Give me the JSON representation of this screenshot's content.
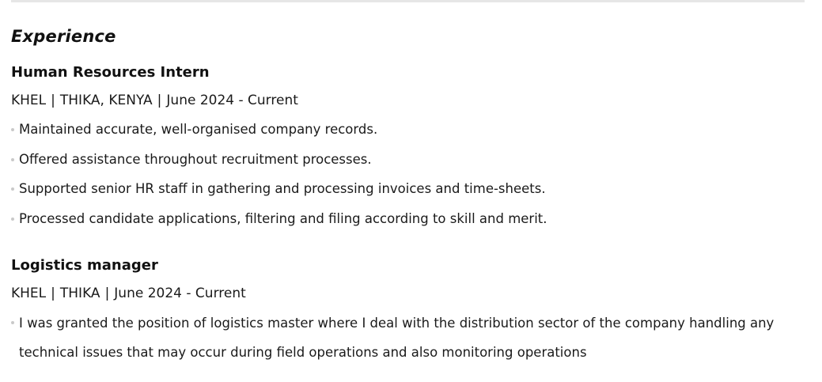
{
  "section": {
    "title": "Experience"
  },
  "jobs": [
    {
      "title": "Human Resources Intern",
      "company": "KHEL",
      "location": "THIKA, KENYA",
      "dates": "June 2024 - Current",
      "separator": "|",
      "bullets": [
        "Maintained accurate, well-organised company records.",
        "Offered assistance throughout recruitment processes.",
        "Supported senior HR staff in gathering and processing invoices and time-sheets.",
        "Processed candidate applications, filtering and filing according to skill and merit."
      ]
    },
    {
      "title": "Logistics manager",
      "company": "KHEL",
      "location": "THIKA",
      "dates": "June 2024 - Current",
      "separator": "|",
      "bullets": [
        "I was granted the position of logistics master where I deal with the distribution sector of the company handling any technical issues that may occur during field operations and also monitoring operations"
      ]
    }
  ]
}
